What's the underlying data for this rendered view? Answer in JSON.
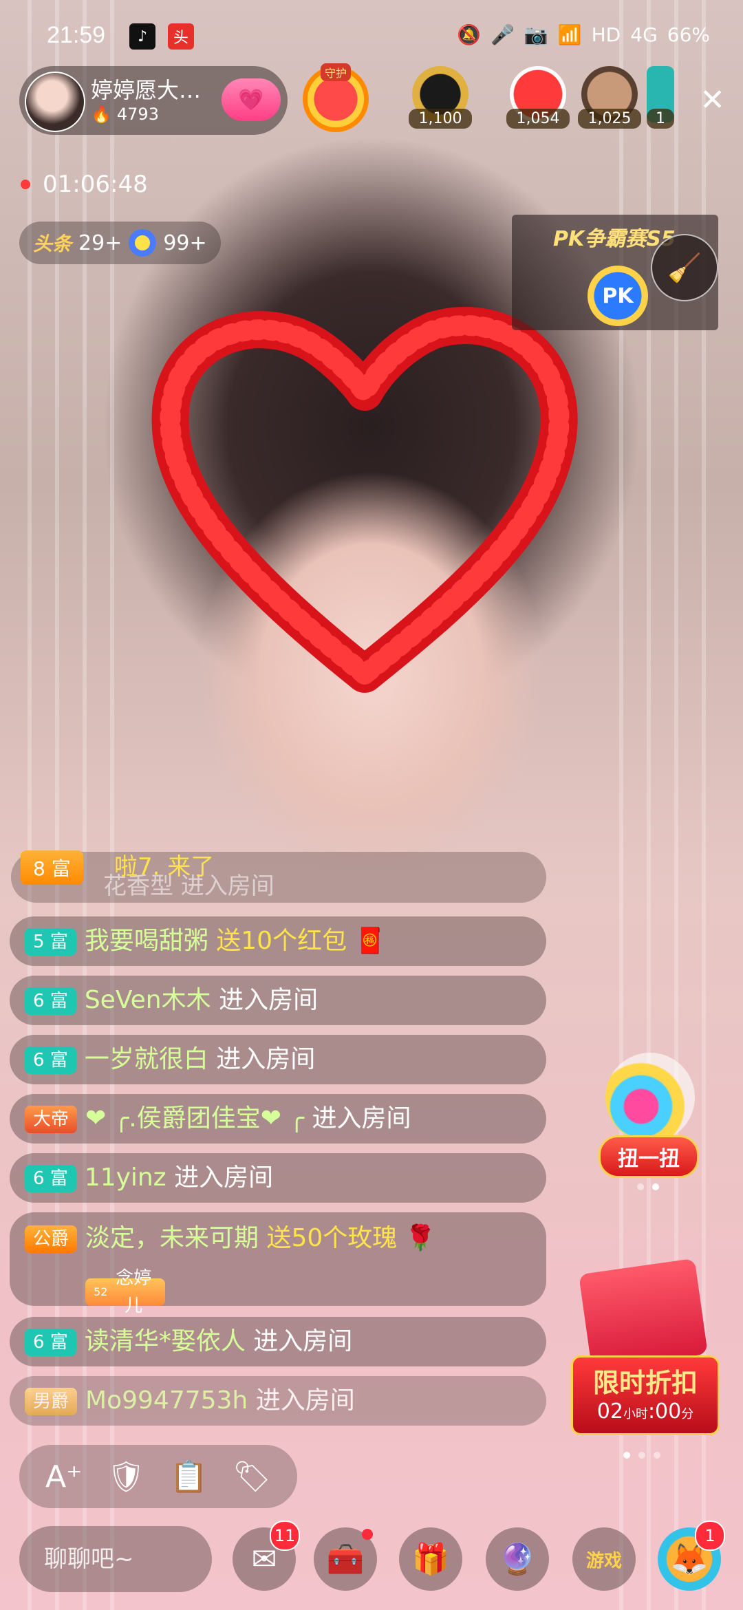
{
  "status_bar": {
    "time": "21:59",
    "left_icons": [
      "tiktok-icon",
      "toutiao-icon"
    ],
    "hd": "HD",
    "net": "4G",
    "battery": "66%"
  },
  "host": {
    "name": "婷婷愿大…",
    "hot": "4793"
  },
  "guard_label": "守护",
  "top_fans": [
    {
      "value": "1,100"
    },
    {
      "value": "1,054"
    },
    {
      "value": "1,025"
    },
    {
      "value": "1"
    }
  ],
  "live_duration": "01:06:48",
  "chips": {
    "toutiao_label": "头条",
    "toutiao_count": "29+",
    "star_count": "99+"
  },
  "pk": {
    "title": "PK争霸赛S5",
    "button": "PK"
  },
  "enter_banner": {
    "level": "8 富",
    "text": "啦7. 来了",
    "ghost": "花香型 进入房间"
  },
  "messages": [
    {
      "badge": "5 富",
      "user": "我要喝甜粥",
      "action": "送10个红包",
      "tail": "🧧",
      "type": "gift"
    },
    {
      "badge": "6 富",
      "user": "SeVen木木",
      "action": "进入房间",
      "type": "enter"
    },
    {
      "badge": "6 富",
      "user": "一岁就很白",
      "action": "进入房间",
      "type": "enter"
    },
    {
      "badge": "大帝",
      "user": "❤ ╭.侯爵团佳宝❤ ╭",
      "action": "进入房间",
      "type": "enter"
    },
    {
      "badge": "6 富",
      "user": "11yinz",
      "action": "进入房间",
      "type": "enter"
    },
    {
      "badge": "公爵",
      "badge2": "念婷儿",
      "badge2_num": "52",
      "user": "淡定，未来可期",
      "action": "送50个玫瑰",
      "tail": "🌹",
      "type": "gift"
    },
    {
      "badge": "6 富",
      "user": "读清华*娶依人",
      "action": "进入房间",
      "type": "enter"
    },
    {
      "badge": "男爵",
      "user": "Mo9947753h",
      "action": "进入房间",
      "type": "enter"
    }
  ],
  "gacha_label": "扭一扭",
  "discount": {
    "title": "限时折扣",
    "h": "02",
    "h_unit": "小时",
    "m": "00",
    "m_unit": "分"
  },
  "chat_placeholder": "聊聊吧~",
  "mail_count": "11",
  "corner_count": "1",
  "game_label": "游戏"
}
